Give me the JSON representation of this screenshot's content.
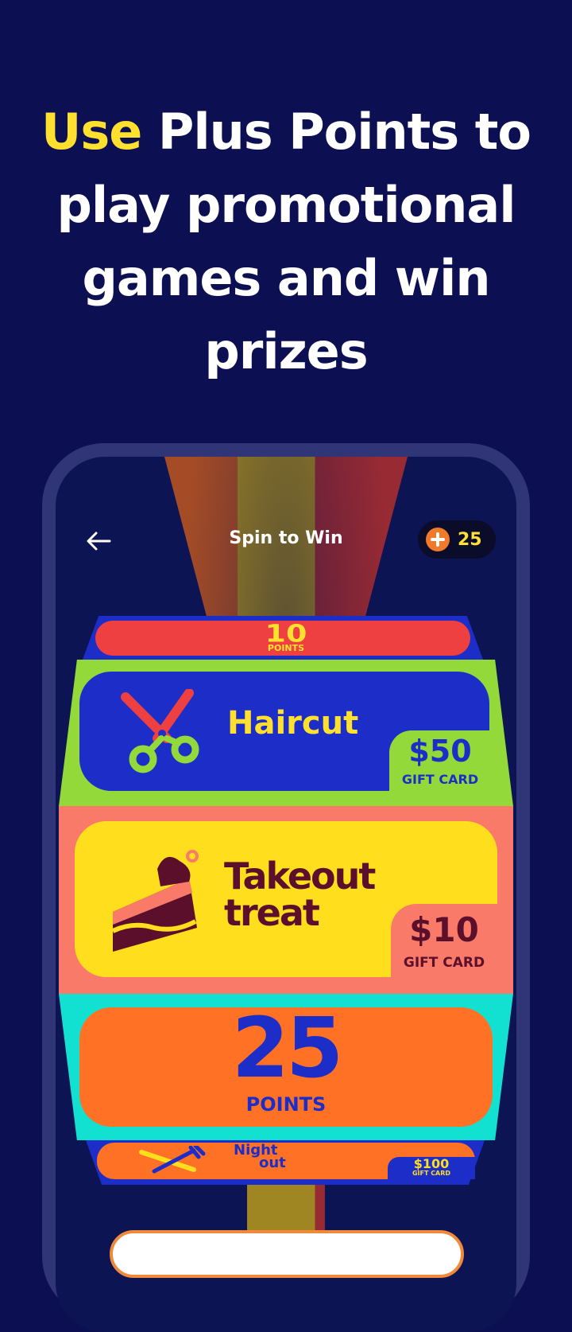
{
  "headline": {
    "highlight": "Use",
    "rest": "Plus Points to play promotional games and win prizes"
  },
  "screen": {
    "title": "Spin to Win",
    "back_icon": "arrow-left-icon",
    "points": {
      "icon": "plus-circle-icon",
      "value": "25"
    }
  },
  "wheel": {
    "top_sliver": {
      "value": "10",
      "unit": "POINTS"
    },
    "haircut": {
      "title": "Haircut",
      "amount": "$50",
      "label": "GIFT CARD",
      "icon": "scissors-icon"
    },
    "takeout": {
      "title_line1": "Takeout",
      "title_line2": "treat",
      "amount": "$10",
      "label": "GIFT CARD",
      "icon": "cake-slice-icon"
    },
    "points25": {
      "value": "25",
      "unit": "POINTS"
    },
    "nightout": {
      "title_line1": "Night",
      "title_line2": "out",
      "amount": "$100",
      "label": "GIFT CARD",
      "icon": "knife-fork-icon"
    }
  },
  "colors": {
    "background": "#0c0f52",
    "accent_yellow": "#ffe02e",
    "orange": "#f07a2a"
  }
}
